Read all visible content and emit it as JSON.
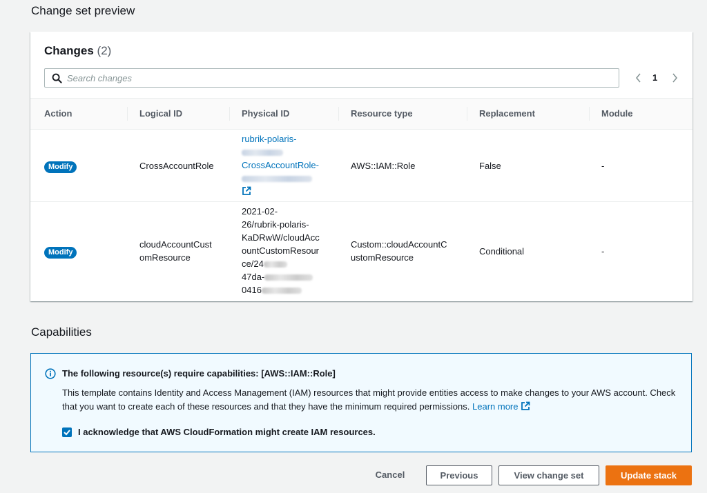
{
  "section_titles": {
    "preview": "Change set preview",
    "capabilities": "Capabilities"
  },
  "changes": {
    "title": "Changes",
    "count": "(2)",
    "search_placeholder": "Search changes",
    "page": "1",
    "columns": [
      "Action",
      "Logical ID",
      "Physical ID",
      "Resource type",
      "Replacement",
      "Module"
    ],
    "rows": [
      {
        "action": "Modify",
        "logical_id": "CrossAccountRole",
        "physical_id_lines": [
          "rubrik-polaris-",
          "CrossAccountRole-"
        ],
        "resource_type": "AWS::IAM::Role",
        "replacement": "False",
        "module": "-"
      },
      {
        "action": "Modify",
        "logical_id_lines": [
          "cloudAccountCust",
          "omResource"
        ],
        "physical_id_lines": [
          "2021-02-",
          "26/rubrik-polaris-",
          "KaDRwW/cloudAcc",
          "ountCustomResour",
          "ce/24",
          "47da-",
          "0416"
        ],
        "resource_type_lines": [
          "Custom::cloudAccountC",
          "ustomResource"
        ],
        "replacement": "Conditional",
        "module": "-"
      }
    ]
  },
  "capabilities": {
    "heading": "The following resource(s) require capabilities: [AWS::IAM::Role]",
    "body": "This template contains Identity and Access Management (IAM) resources that might provide entities access to make changes to your AWS account. Check that you want to create each of these resources and that they have the minimum required permissions.",
    "learn_more": "Learn more",
    "acknowledge": "I acknowledge that AWS CloudFormation might create IAM resources.",
    "acknowledged": true
  },
  "footer": {
    "cancel": "Cancel",
    "previous": "Previous",
    "view_change_set": "View change set",
    "update_stack": "Update stack"
  },
  "colors": {
    "accent": "#0073bb",
    "primary_button": "#ec7211",
    "info_background": "#f1faff"
  }
}
